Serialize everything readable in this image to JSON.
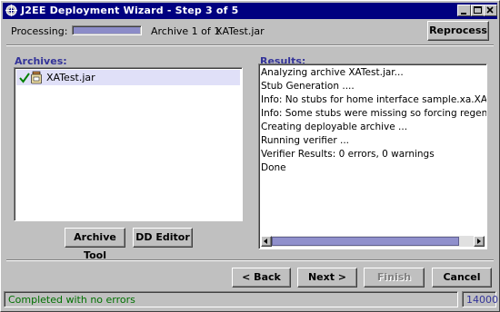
{
  "window": {
    "title": "J2EE Deployment Wizard - Step 3 of 5"
  },
  "processing": {
    "label": "Processing:",
    "progress": 1.0,
    "archive_count": "Archive 1 of 1",
    "archive_name": "XATest.jar",
    "reprocess_label": "Reprocess"
  },
  "archives": {
    "heading": "Archives:",
    "items": [
      {
        "name": "XATest.jar",
        "status": "ok"
      }
    ],
    "archive_tool_label": "Archive Tool",
    "dd_editor_label": "DD Editor"
  },
  "results": {
    "heading": "Results:",
    "lines": [
      "Analyzing archive XATest.jar...",
      "Stub Generation ....",
      "Info: No stubs for home interface sample.xa.XATdsHo",
      "Info: Some stubs were missing so forcing regeneratio",
      "Creating deployable archive ...",
      "Running verifier ...",
      "Verifier Results: 0 errors, 0 warnings",
      "Done"
    ]
  },
  "nav": {
    "back_label": "< Back",
    "next_label": "Next >",
    "finish_label": "Finish",
    "cancel_label": "Cancel"
  },
  "status": {
    "message": "Completed with no errors",
    "code": "14000",
    "message_color": "#007000"
  }
}
